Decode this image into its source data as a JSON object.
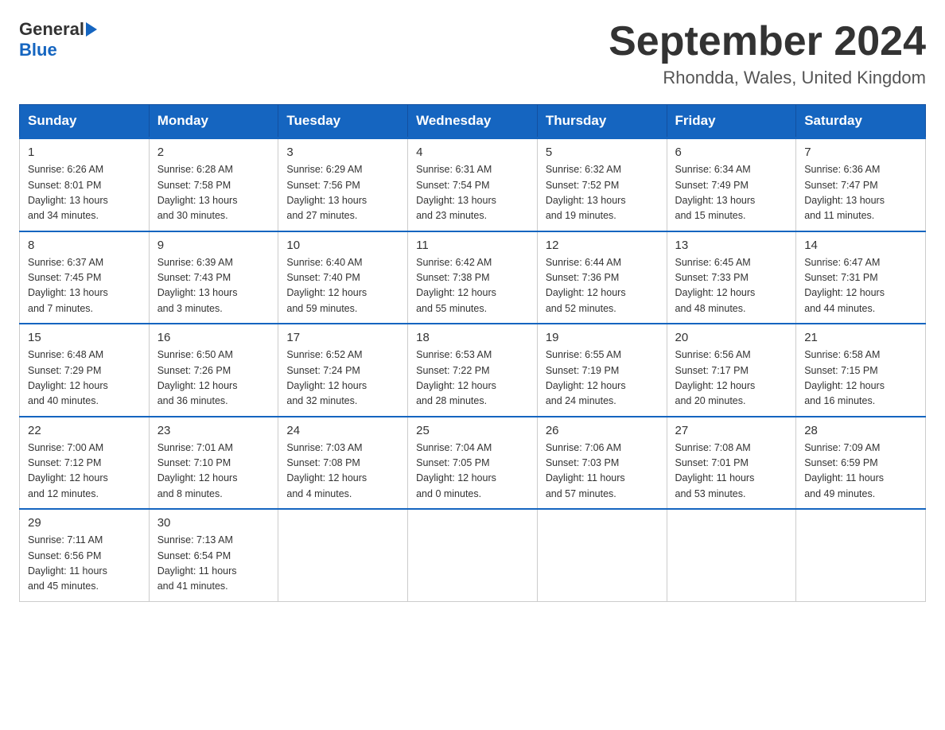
{
  "header": {
    "logo_line1": "General",
    "logo_arrow": "▶",
    "logo_line2": "Blue",
    "month_title": "September 2024",
    "location": "Rhondda, Wales, United Kingdom"
  },
  "weekdays": [
    "Sunday",
    "Monday",
    "Tuesday",
    "Wednesday",
    "Thursday",
    "Friday",
    "Saturday"
  ],
  "weeks": [
    [
      {
        "day": "1",
        "sunrise": "6:26 AM",
        "sunset": "8:01 PM",
        "daylight": "13 hours and 34 minutes."
      },
      {
        "day": "2",
        "sunrise": "6:28 AM",
        "sunset": "7:58 PM",
        "daylight": "13 hours and 30 minutes."
      },
      {
        "day": "3",
        "sunrise": "6:29 AM",
        "sunset": "7:56 PM",
        "daylight": "13 hours and 27 minutes."
      },
      {
        "day": "4",
        "sunrise": "6:31 AM",
        "sunset": "7:54 PM",
        "daylight": "13 hours and 23 minutes."
      },
      {
        "day": "5",
        "sunrise": "6:32 AM",
        "sunset": "7:52 PM",
        "daylight": "13 hours and 19 minutes."
      },
      {
        "day": "6",
        "sunrise": "6:34 AM",
        "sunset": "7:49 PM",
        "daylight": "13 hours and 15 minutes."
      },
      {
        "day": "7",
        "sunrise": "6:36 AM",
        "sunset": "7:47 PM",
        "daylight": "13 hours and 11 minutes."
      }
    ],
    [
      {
        "day": "8",
        "sunrise": "6:37 AM",
        "sunset": "7:45 PM",
        "daylight": "13 hours and 7 minutes."
      },
      {
        "day": "9",
        "sunrise": "6:39 AM",
        "sunset": "7:43 PM",
        "daylight": "13 hours and 3 minutes."
      },
      {
        "day": "10",
        "sunrise": "6:40 AM",
        "sunset": "7:40 PM",
        "daylight": "12 hours and 59 minutes."
      },
      {
        "day": "11",
        "sunrise": "6:42 AM",
        "sunset": "7:38 PM",
        "daylight": "12 hours and 55 minutes."
      },
      {
        "day": "12",
        "sunrise": "6:44 AM",
        "sunset": "7:36 PM",
        "daylight": "12 hours and 52 minutes."
      },
      {
        "day": "13",
        "sunrise": "6:45 AM",
        "sunset": "7:33 PM",
        "daylight": "12 hours and 48 minutes."
      },
      {
        "day": "14",
        "sunrise": "6:47 AM",
        "sunset": "7:31 PM",
        "daylight": "12 hours and 44 minutes."
      }
    ],
    [
      {
        "day": "15",
        "sunrise": "6:48 AM",
        "sunset": "7:29 PM",
        "daylight": "12 hours and 40 minutes."
      },
      {
        "day": "16",
        "sunrise": "6:50 AM",
        "sunset": "7:26 PM",
        "daylight": "12 hours and 36 minutes."
      },
      {
        "day": "17",
        "sunrise": "6:52 AM",
        "sunset": "7:24 PM",
        "daylight": "12 hours and 32 minutes."
      },
      {
        "day": "18",
        "sunrise": "6:53 AM",
        "sunset": "7:22 PM",
        "daylight": "12 hours and 28 minutes."
      },
      {
        "day": "19",
        "sunrise": "6:55 AM",
        "sunset": "7:19 PM",
        "daylight": "12 hours and 24 minutes."
      },
      {
        "day": "20",
        "sunrise": "6:56 AM",
        "sunset": "7:17 PM",
        "daylight": "12 hours and 20 minutes."
      },
      {
        "day": "21",
        "sunrise": "6:58 AM",
        "sunset": "7:15 PM",
        "daylight": "12 hours and 16 minutes."
      }
    ],
    [
      {
        "day": "22",
        "sunrise": "7:00 AM",
        "sunset": "7:12 PM",
        "daylight": "12 hours and 12 minutes."
      },
      {
        "day": "23",
        "sunrise": "7:01 AM",
        "sunset": "7:10 PM",
        "daylight": "12 hours and 8 minutes."
      },
      {
        "day": "24",
        "sunrise": "7:03 AM",
        "sunset": "7:08 PM",
        "daylight": "12 hours and 4 minutes."
      },
      {
        "day": "25",
        "sunrise": "7:04 AM",
        "sunset": "7:05 PM",
        "daylight": "12 hours and 0 minutes."
      },
      {
        "day": "26",
        "sunrise": "7:06 AM",
        "sunset": "7:03 PM",
        "daylight": "11 hours and 57 minutes."
      },
      {
        "day": "27",
        "sunrise": "7:08 AM",
        "sunset": "7:01 PM",
        "daylight": "11 hours and 53 minutes."
      },
      {
        "day": "28",
        "sunrise": "7:09 AM",
        "sunset": "6:59 PM",
        "daylight": "11 hours and 49 minutes."
      }
    ],
    [
      {
        "day": "29",
        "sunrise": "7:11 AM",
        "sunset": "6:56 PM",
        "daylight": "11 hours and 45 minutes."
      },
      {
        "day": "30",
        "sunrise": "7:13 AM",
        "sunset": "6:54 PM",
        "daylight": "11 hours and 41 minutes."
      },
      null,
      null,
      null,
      null,
      null
    ]
  ]
}
